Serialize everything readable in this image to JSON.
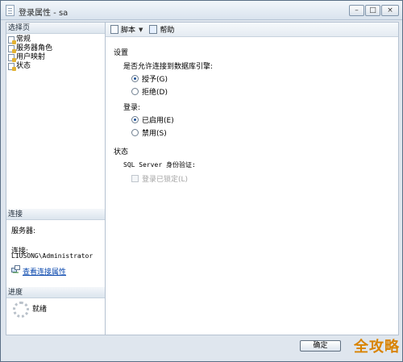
{
  "window": {
    "title": "登录属性 - sa"
  },
  "left_pane": {
    "select_page_header": "选择页",
    "pages": [
      {
        "label": "常规"
      },
      {
        "label": "服务器角色"
      },
      {
        "label": "用户映射"
      },
      {
        "label": "状态"
      }
    ],
    "connection_header": "连接",
    "server_label": "服务器:",
    "connection_label": "连接:",
    "connection_value": "LIUSONG\\Administrator",
    "view_connection_link": "查看连接属性",
    "progress_header": "进度",
    "progress_status": "就绪"
  },
  "toolbar": {
    "script_label": "脚本",
    "help_label": "帮助"
  },
  "settings": {
    "section_label": "设置",
    "permission_question": "是否允许连接到数据库引擎:",
    "grant_label": "授予(G)",
    "deny_label": "拒绝(D)",
    "login_label": "登录:",
    "enabled_label": "已启用(E)",
    "disabled_label": "禁用(S)"
  },
  "status": {
    "section_label": "状态",
    "sql_auth_label": "SQL Server 身份验证:",
    "locked_out_label": "登录已锁定(L)"
  },
  "footer": {
    "ok_label": "确定",
    "watermark_text": "全攻略"
  }
}
